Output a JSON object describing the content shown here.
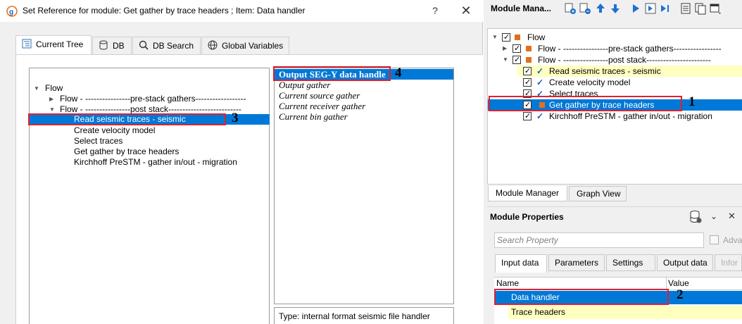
{
  "dialog": {
    "title": "Set Reference for module: Get gather by trace headers ; Item: Data handler",
    "help": "?",
    "close": "✕",
    "tabs": [
      {
        "label": "Current Tree",
        "icon": "tree-icon"
      },
      {
        "label": "DB",
        "icon": "database-icon"
      },
      {
        "label": "DB Search",
        "icon": "search-icon"
      },
      {
        "label": "Global Variables",
        "icon": "globe-icon"
      }
    ],
    "tree": {
      "root": "Flow",
      "items": [
        "Flow - ----------------pre-stack gathers------------------",
        "Flow - ----------------post stack--------------------------",
        "Read seismic traces - seismic",
        "Create velocity model",
        "Select traces",
        "Get gather by trace headers",
        "Kirchhoff PreSTM - gather in/out - migration"
      ]
    },
    "list": {
      "items": [
        "Output SEG-Y data handle",
        "Output gather",
        "Current source gather",
        "Current receiver gather",
        "Current bin gather"
      ]
    },
    "description": "Type: internal format seismic file handler"
  },
  "annotations": [
    "1",
    "2",
    "3",
    "4"
  ],
  "module_manager": {
    "title": "Module Mana...",
    "tree": [
      "Flow",
      "Flow - ----------------pre-stack gathers-----------------",
      "Flow - ----------------post stack-----------------------",
      "Read seismic traces - seismic",
      "Create velocity model",
      "Select traces",
      "Get gather by trace headers",
      "Kirchhoff PreSTM - gather in/out - migration"
    ],
    "bottom_tabs": [
      "Module Manager",
      "Graph View"
    ]
  },
  "module_properties": {
    "title": "Module Properties",
    "search_placeholder": "Search Property",
    "advanced_label": "Adva",
    "tabs": [
      "Input data",
      "Parameters",
      "Settings",
      "Output data",
      "Infor"
    ],
    "columns": [
      "Name",
      "Value"
    ],
    "rows": [
      "Data handler",
      "Trace headers"
    ]
  },
  "colors": {
    "selection": "#0078d7",
    "highlight_yellow": "#ffffc0",
    "annotation_red": "#e0202e",
    "module_orange": "#e07020"
  }
}
